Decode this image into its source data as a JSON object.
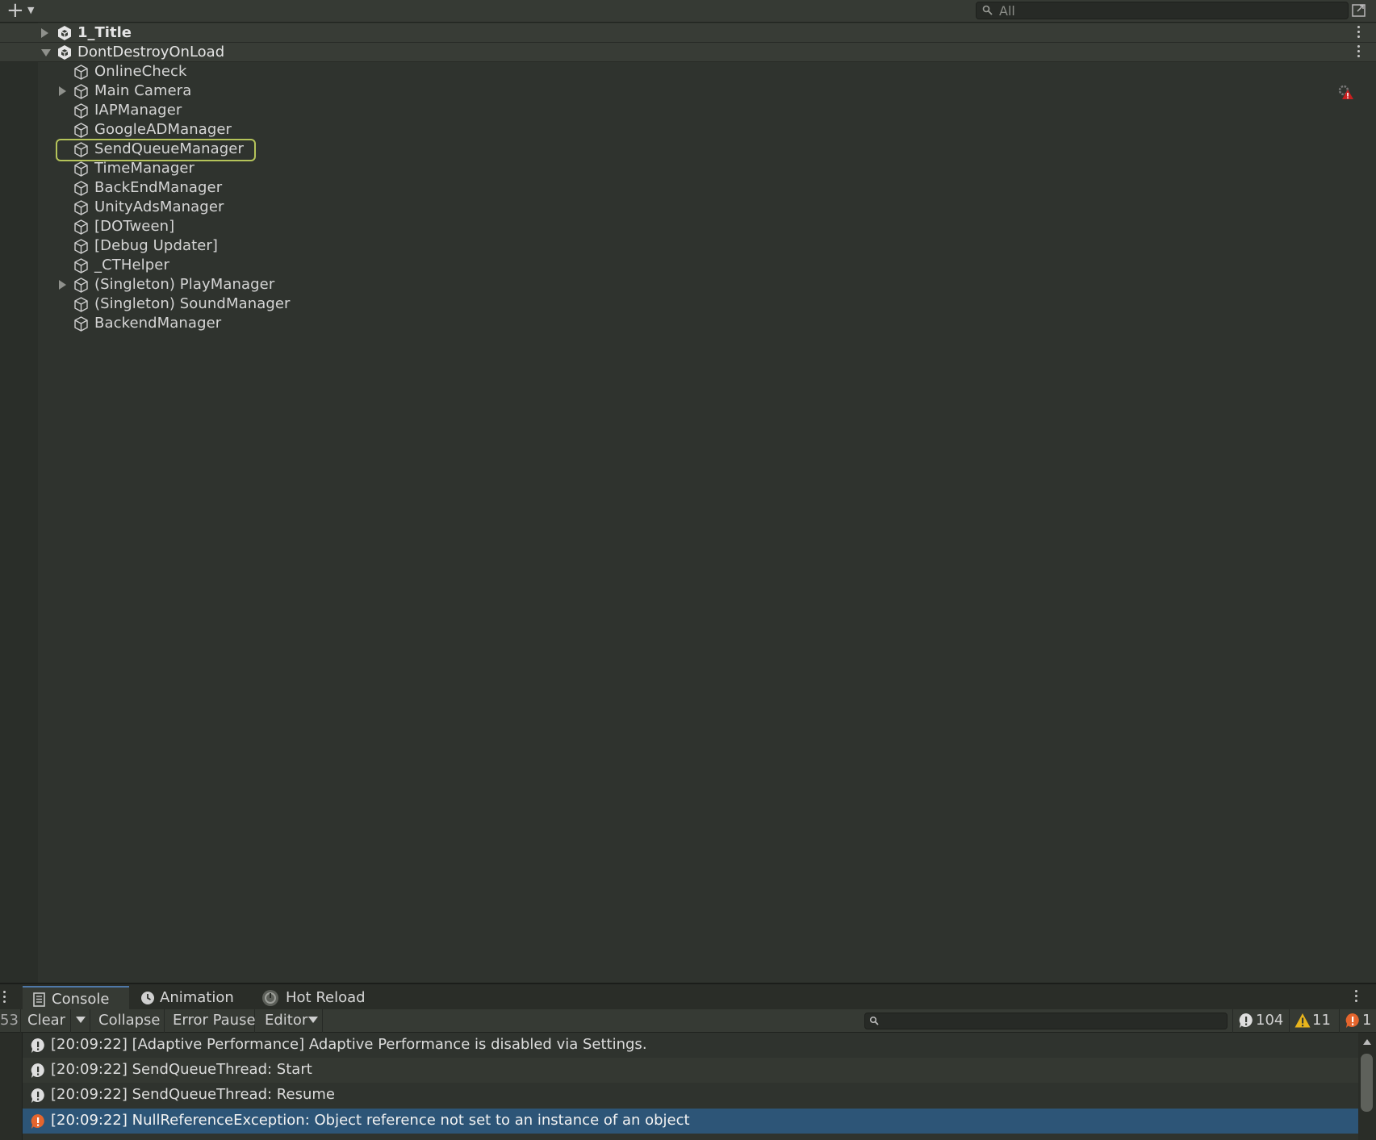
{
  "hierarchy": {
    "search_placeholder": "All",
    "scenes": [
      {
        "name": "1_Title",
        "expanded": false,
        "bold": true
      },
      {
        "name": "DontDestroyOnLoad",
        "expanded": true,
        "bold": false
      }
    ],
    "objects": [
      {
        "name": "OnlineCheck",
        "has_children": false
      },
      {
        "name": "Main Camera",
        "has_children": true
      },
      {
        "name": "IAPManager",
        "has_children": false
      },
      {
        "name": "GoogleADManager",
        "has_children": false
      },
      {
        "name": "SendQueueManager",
        "has_children": false,
        "selected": true
      },
      {
        "name": "TimeManager",
        "has_children": false
      },
      {
        "name": "BackEndManager",
        "has_children": false
      },
      {
        "name": "UnityAdsManager",
        "has_children": false
      },
      {
        "name": "[DOTween]",
        "has_children": false
      },
      {
        "name": "[Debug Updater]",
        "has_children": false
      },
      {
        "name": "_CTHelper",
        "has_children": false
      },
      {
        "name": "(Singleton) PlayManager",
        "has_children": true
      },
      {
        "name": "(Singleton) SoundManager",
        "has_children": false
      },
      {
        "name": "BackendManager",
        "has_children": false
      }
    ]
  },
  "console_panel": {
    "tabs": [
      {
        "label": "Console",
        "icon": "console-icon",
        "active": true
      },
      {
        "label": "Animation",
        "icon": "animation-clock-icon",
        "active": false
      },
      {
        "label": "Hot Reload",
        "icon": "hot-reload-icon",
        "active": false
      }
    ],
    "toolbar": {
      "left_count": "53",
      "clear": "Clear",
      "collapse": "Collapse",
      "error_pause": "Error Pause",
      "editor": "Editor"
    },
    "counts": {
      "info": "104",
      "warnings": "11",
      "errors": "1"
    },
    "logs": [
      {
        "type": "info",
        "text": "[20:09:22] [Adaptive Performance] Adaptive Performance is disabled via Settings."
      },
      {
        "type": "info",
        "text": "[20:09:22] SendQueueThread: Start"
      },
      {
        "type": "info",
        "text": "[20:09:22] SendQueueThread: Resume"
      },
      {
        "type": "error",
        "text": "[20:09:22] NullReferenceException: Object reference not set to an instance of an object",
        "selected": true
      }
    ]
  },
  "colors": {
    "background": "#2f332e",
    "selection_outline": "#b5c45a",
    "selected_log": "#2d5577",
    "warning": "#e8b41c",
    "error": "#e5652d"
  }
}
